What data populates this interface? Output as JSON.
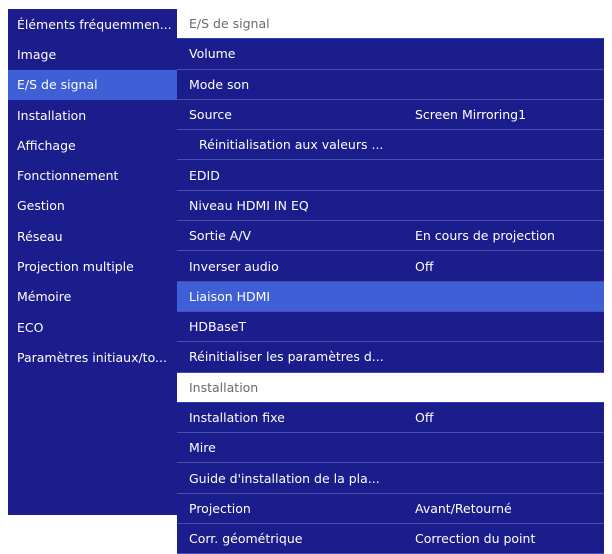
{
  "sidebar": {
    "items": [
      {
        "label": "Éléments fréquemmen..."
      },
      {
        "label": "Image"
      },
      {
        "label": "E/S de signal"
      },
      {
        "label": "Installation"
      },
      {
        "label": "Affichage"
      },
      {
        "label": "Fonctionnement"
      },
      {
        "label": "Gestion"
      },
      {
        "label": "Réseau"
      },
      {
        "label": "Projection multiple"
      },
      {
        "label": "Mémoire"
      },
      {
        "label": "ECO"
      },
      {
        "label": "Paramètres initiaux/to..."
      }
    ]
  },
  "main": {
    "signal_header": "E/S de signal",
    "signal_items": [
      {
        "label": "Volume",
        "value": ""
      },
      {
        "label": "Mode son",
        "value": ""
      },
      {
        "label": "Source",
        "value": "Screen Mirroring1"
      },
      {
        "label": "Réinitialisation aux valeurs ...",
        "value": ""
      },
      {
        "label": "EDID",
        "value": ""
      },
      {
        "label": "Niveau HDMI IN EQ",
        "value": ""
      },
      {
        "label": "Sortie A/V",
        "value": "En cours de projection"
      },
      {
        "label": "Inverser audio",
        "value": "Off"
      },
      {
        "label": "Liaison HDMI",
        "value": ""
      },
      {
        "label": "HDBaseT",
        "value": ""
      },
      {
        "label": "Réinitialiser les paramètres d...",
        "value": ""
      }
    ],
    "install_header": "Installation",
    "install_items": [
      {
        "label": "Installation fixe",
        "value": "Off"
      },
      {
        "label": "Mire",
        "value": ""
      },
      {
        "label": "Guide d'installation de la pla...",
        "value": ""
      },
      {
        "label": "Projection",
        "value": "Avant/Retourné"
      },
      {
        "label": "Corr. géométrique",
        "value": "Correction du point"
      }
    ]
  },
  "colors": {
    "menu_background": "#1c1d8d",
    "highlight": "#3f5fd6",
    "header_text": "#6a6a6a"
  }
}
